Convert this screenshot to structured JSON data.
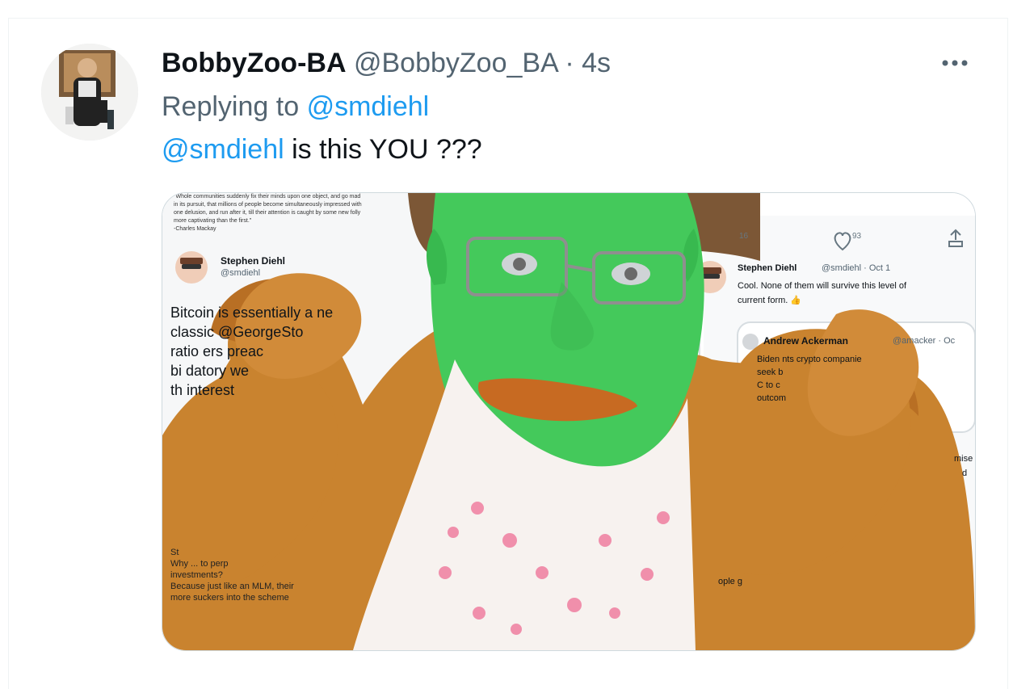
{
  "tweet": {
    "author_name": "BobbyZoo-BA",
    "author_handle": "@BobbyZoo_BA",
    "separator": "·",
    "timestamp": "4s",
    "replying_prefix": "Replying to",
    "replying_to": "@smdiehl",
    "body_mention": "@smdiehl",
    "body_text": "is this YOU ???"
  },
  "media": {
    "left_tweet_header": "Stephen Diehl",
    "left_tweet_handle": "@smdiehl",
    "left_quote_lines": [
      "\"Whole communities suddenly fix their minds upon one object, and go mad",
      "in its pursuit, that millions of people become simultaneously impressed with",
      "one delusion, and run after it, till their attention is caught by some new folly",
      "more captivating than the first.\"",
      "-Charles Mackay"
    ],
    "left_body_lines": [
      "Bitcoin is essentially a ne",
      "classic @GeorgeSto",
      "ratio      ers preac",
      "bi       datory we",
      "th         interest"
    ],
    "left_bottom_lines": [
      "St",
      "Why ...                    to perp",
      "investments?",
      "",
      "Because just like an MLM, their",
      "more suckers into the scheme"
    ],
    "right_counts": {
      "retweets": "16",
      "likes": "93"
    },
    "right_tweet_header": "Stephen Diehl",
    "right_tweet_handle": "@smdiehl · Oct 1",
    "right_tweet_text_1": "Cool. None of them will survive this level of",
    "right_tweet_text_2": "current form. 👍",
    "right_quoted_name": "Andrew Ackerman",
    "right_quoted_handle": "@amacker · Oc",
    "right_quoted_lines": [
      "Biden        nts crypto companie",
      "                         seek b",
      "                         C to c",
      "                         outcom"
    ],
    "right_small_snips": [
      "mise",
      "d",
      "ople g"
    ]
  },
  "colors": {
    "link": "#1d9bf0",
    "secondary": "#536471",
    "text": "#0f1419",
    "border": "#cfd9de",
    "fur": "#c9832f",
    "face": "#44c95b",
    "lips": "#c76a22",
    "scarf_dots": "#f08aa8"
  },
  "icons": {
    "more": "more-horizontal-icon",
    "verified": "verified-badge-icon",
    "retweet": "retweet-icon",
    "like": "heart-icon",
    "share": "share-icon"
  }
}
